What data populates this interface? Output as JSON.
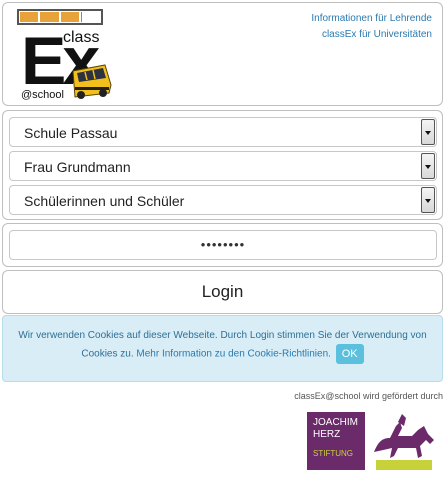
{
  "header": {
    "logo": {
      "word_class": "class",
      "word_ex": "Ex",
      "word_school": "@school"
    },
    "links": [
      "Informationen für Lehrende",
      "classEx für Universitäten"
    ]
  },
  "selects": {
    "school": "Schule Passau",
    "teacher": "Frau Grundmann",
    "group": "Schülerinnen und Schüler"
  },
  "password": {
    "value": "••••••••"
  },
  "login": {
    "label": "Login"
  },
  "cookie": {
    "text_part1": "Wir verwenden Cookies auf dieser Webseite. Durch Login stimmen Sie der Verwendung von Cookies zu.",
    "link": "Mehr Information zu den Cookie-Richtlinien.",
    "ok": "OK"
  },
  "sponsor": {
    "text": "classEx@school wird gefördert durch",
    "logo_lines": [
      "JOACHIM",
      "HERZ"
    ],
    "logo_sub": "STIFTUNG"
  },
  "colors": {
    "accent": "#2a7ab0",
    "cookie_bg": "#d8edf6",
    "ok": "#5bc0de",
    "sponsor_purple": "#6b2a6a",
    "sponsor_green": "#c7d23a"
  }
}
